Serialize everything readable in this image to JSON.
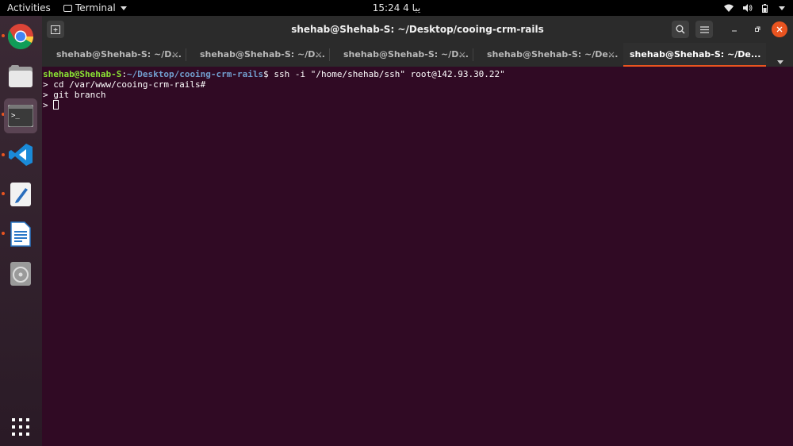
{
  "topbar": {
    "activities": "Activities",
    "app_menu": "Terminal",
    "clock": "15:24 4 يبا"
  },
  "dock": {
    "items": [
      "chrome-icon",
      "files-icon",
      "terminal-icon",
      "vscode-icon",
      "text-editor-icon",
      "writer-icon",
      "disc-icon",
      "app-grid-icon"
    ]
  },
  "window": {
    "title": "shehab@Shehab-S: ~/Desktop/cooing-crm-rails",
    "tabs": [
      {
        "label": "shehab@Shehab-S: ~/D..."
      },
      {
        "label": "shehab@Shehab-S: ~/D..."
      },
      {
        "label": "shehab@Shehab-S: ~/D..."
      },
      {
        "label": "shehab@Shehab-S: ~/De..."
      },
      {
        "label": "shehab@Shehab-S: ~/De..."
      }
    ],
    "tab_close": "×"
  },
  "terminal": {
    "prompt_user": "shehab@Shehab-S",
    "prompt_sep": ":",
    "prompt_path": "~/Desktop/cooing-crm-rails",
    "prompt_dollar": "$ ",
    "command1": "ssh -i \"/home/shehab/ssh\" root@142.93.30.22\"",
    "line2": "> cd /var/www/cooing-crm-rails#",
    "line3": "> git branch",
    "line4": "> "
  },
  "colors": {
    "background": "#300a24",
    "accent": "#e95420",
    "prompt_user": "#8ae234",
    "prompt_path": "#729fcf"
  }
}
